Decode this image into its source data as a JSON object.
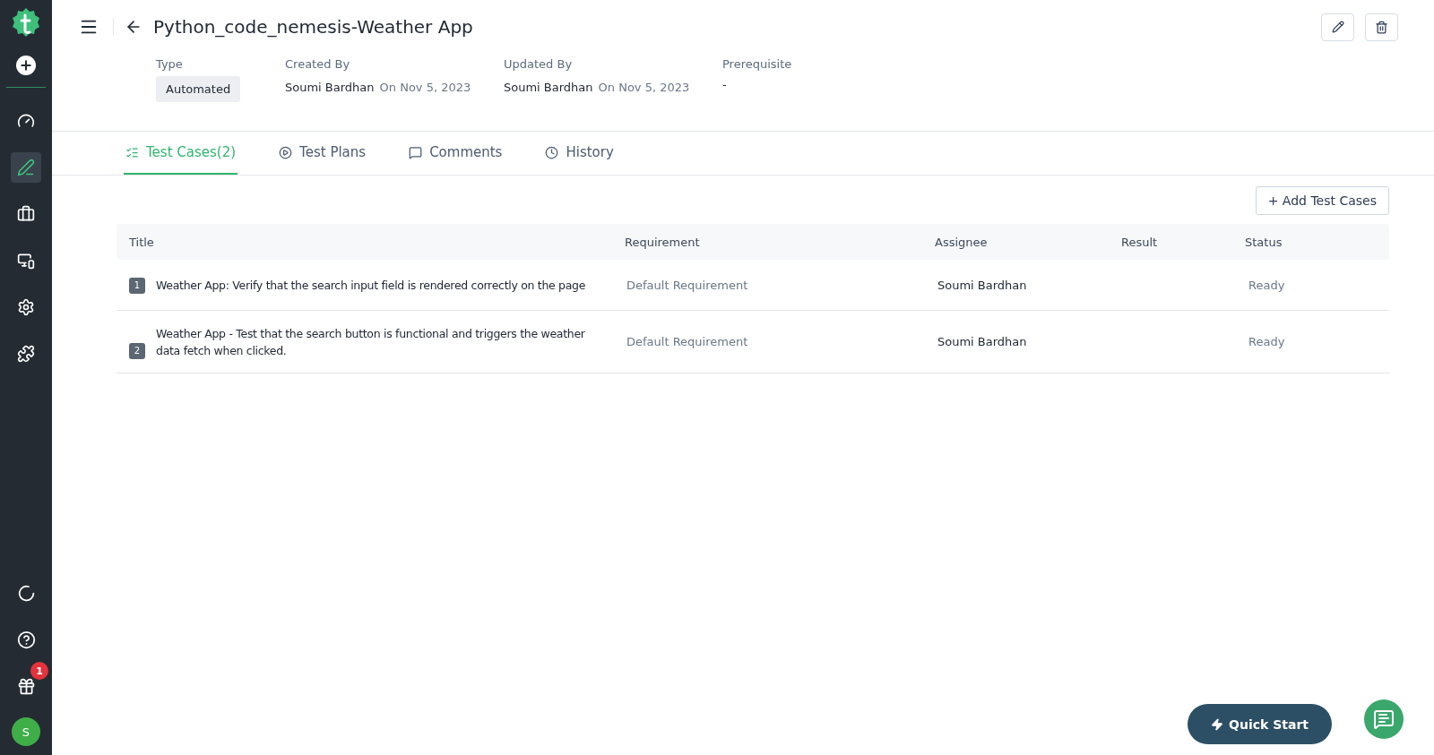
{
  "sidebar": {
    "top_items": [
      {
        "selected": false
      },
      {
        "selected": true
      },
      {
        "selected": false
      },
      {
        "selected": false
      },
      {
        "selected": false
      },
      {
        "selected": false
      }
    ],
    "bottom_items": [
      {
        "selected": false
      },
      {
        "selected": false
      },
      {
        "selected": false,
        "badge": "1"
      }
    ],
    "avatar": "S"
  },
  "header": {
    "title": "Python_code_nemesis-Weather App"
  },
  "meta": [
    {
      "kind": "tag",
      "label": "Type",
      "value": "Automated"
    },
    {
      "kind": "person",
      "label": "Created By",
      "name": "Soumi Bardhan",
      "date": "On Nov 5, 2023"
    },
    {
      "kind": "person",
      "label": "Updated By",
      "name": "Soumi Bardhan",
      "date": "On Nov 5, 2023"
    },
    {
      "kind": "plain",
      "label": "Prerequisite",
      "value": "-"
    }
  ],
  "tabs": [
    {
      "label": "Test Cases(2)",
      "selected": true
    },
    {
      "label": "Test Plans",
      "selected": false
    },
    {
      "label": "Comments",
      "selected": false
    },
    {
      "label": "History",
      "selected": false
    }
  ],
  "add_button": "+ Add Test Cases",
  "table": {
    "columns": [
      "Title",
      "Requirement",
      "Assignee",
      "Result",
      "Status"
    ],
    "rows": [
      {
        "index": "1",
        "title": "Weather App: Verify that the search input field is rendered correctly on the page",
        "requirement": "Default Requirement",
        "assignee": "Soumi Bardhan",
        "status": "Ready"
      },
      {
        "index": "2",
        "title": "Weather App - Test that the search button is functional and triggers the weather data fetch when clicked.",
        "requirement": "Default Requirement",
        "assignee": "Soumi Bardhan",
        "status": "Ready"
      }
    ]
  },
  "quick_start": "Quick Start"
}
